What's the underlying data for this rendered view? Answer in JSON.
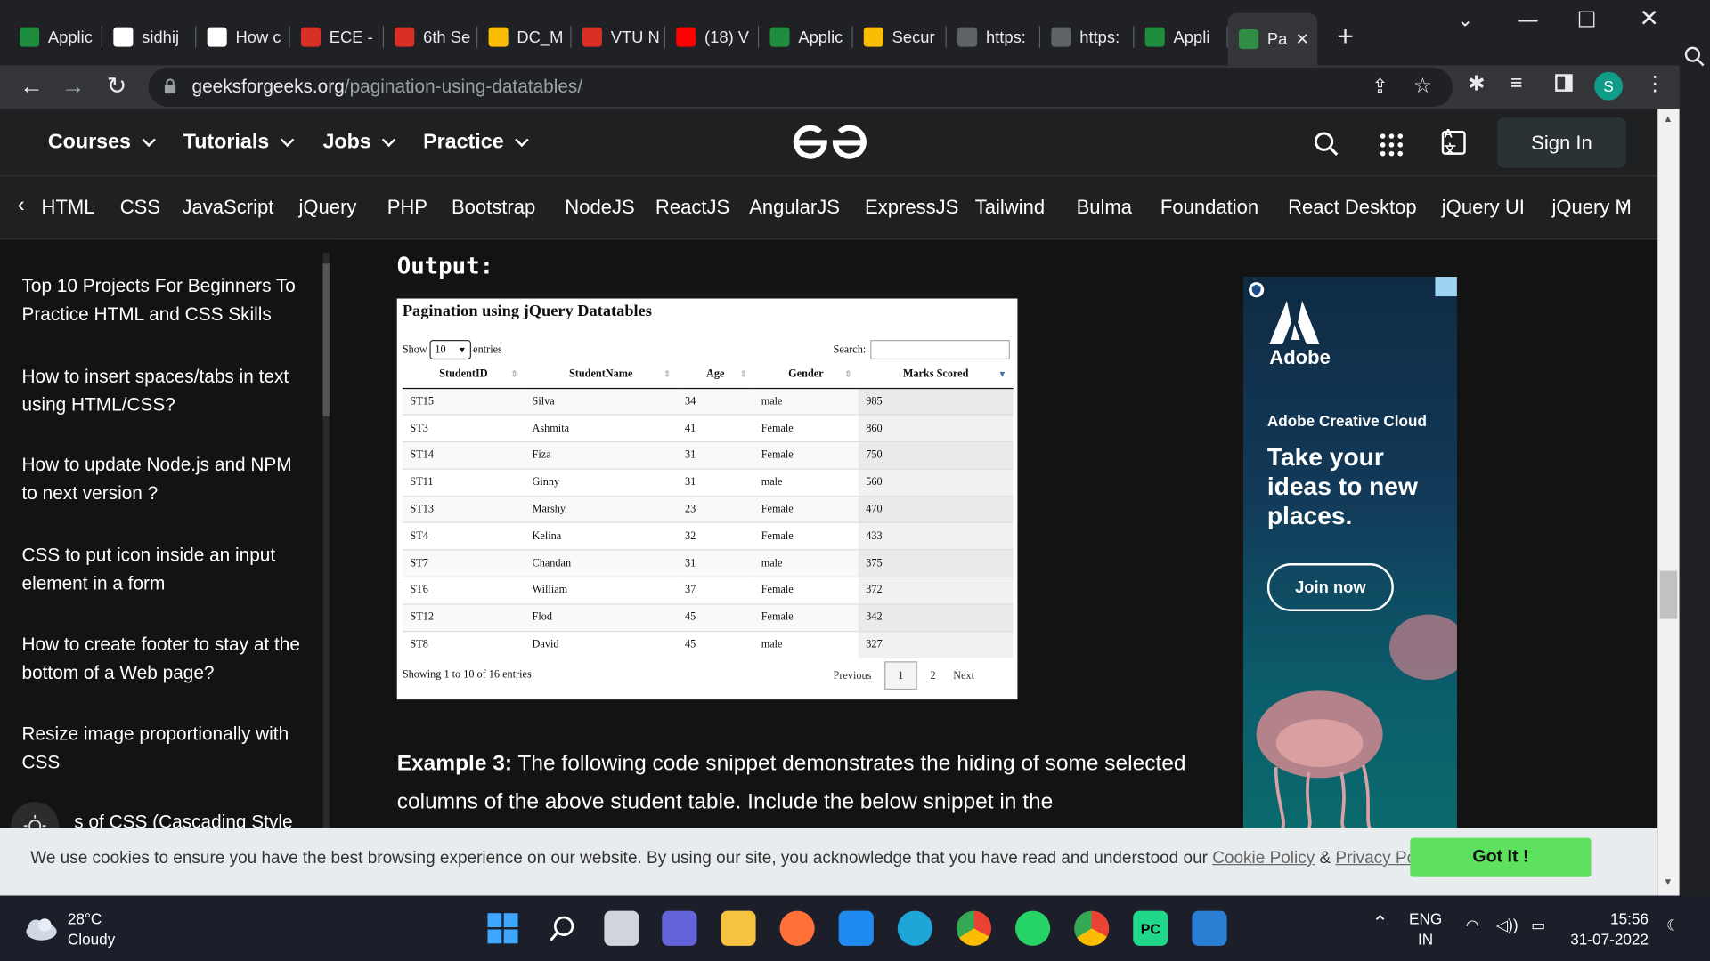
{
  "browser": {
    "tabs": [
      {
        "title": "Applic",
        "icon": "form-app-icon",
        "color": "#1e8e3e"
      },
      {
        "title": "sidhij",
        "icon": "github-icon",
        "color": "#ffffff"
      },
      {
        "title": "How c",
        "icon": "google-icon",
        "color": "#ffffff"
      },
      {
        "title": "ECE -",
        "icon": "pdf-icon",
        "color": "#d93025"
      },
      {
        "title": "6th Se",
        "icon": "pdf-icon",
        "color": "#d93025"
      },
      {
        "title": "DC_M",
        "icon": "drive-icon",
        "color": "#fbbc04"
      },
      {
        "title": "VTU N",
        "icon": "vtu-icon",
        "color": "#d93025"
      },
      {
        "title": "(18) V",
        "icon": "youtube-icon",
        "color": "#ff0000"
      },
      {
        "title": "Applic",
        "icon": "form-app-icon",
        "color": "#1e8e3e"
      },
      {
        "title": "Secur",
        "icon": "drive-icon",
        "color": "#fbbc04"
      },
      {
        "title": "https:",
        "icon": "loading-icon",
        "color": "#5f6368"
      },
      {
        "title": "https:",
        "icon": "loading-icon",
        "color": "#5f6368"
      },
      {
        "title": "Appli",
        "icon": "form-app-icon",
        "color": "#1e8e3e"
      },
      {
        "title": "Pa",
        "icon": "gfg-icon",
        "color": "#2f8d46",
        "active": true
      }
    ],
    "url_host": "geeksforgeeks.org",
    "url_path": "/pagination-using-datatables/",
    "profile_initial": "S"
  },
  "gfg_header": {
    "menus": [
      "Courses",
      "Tutorials",
      "Jobs",
      "Practice"
    ],
    "sign_in": "Sign In"
  },
  "subnav": [
    "HTML",
    "CSS",
    "JavaScript",
    "jQuery",
    "PHP",
    "Bootstrap",
    "NodeJS",
    "ReactJS",
    "AngularJS",
    "ExpressJS",
    "Tailwind",
    "Bulma",
    "Foundation",
    "React Desktop",
    "jQuery UI",
    "jQuery M"
  ],
  "sidebar": {
    "items": [
      "Top 10 Projects For Beginners To Practice HTML and CSS Skills",
      "How to insert spaces/tabs in text using HTML/CSS?",
      "How to update Node.js and NPM to next version ?",
      "CSS to put icon inside an input element in a form",
      "How to create footer to stay at the bottom of a Web page?",
      "Resize image proportionally with CSS",
      "s of CSS (Cascading Style"
    ]
  },
  "content": {
    "output_label": "Output:",
    "demo": {
      "title": "Pagination using jQuery Datatables",
      "show_label": "Show",
      "page_size": "10",
      "entries_label": "entries",
      "search_label": "Search:",
      "columns": [
        "StudentID",
        "StudentName",
        "Age",
        "Gender",
        "Marks Scored"
      ],
      "rows": [
        [
          "ST15",
          "Silva",
          "34",
          "male",
          "985"
        ],
        [
          "ST3",
          "Ashmita",
          "41",
          "Female",
          "860"
        ],
        [
          "ST14",
          "Fiza",
          "31",
          "Female",
          "750"
        ],
        [
          "ST11",
          "Ginny",
          "31",
          "male",
          "560"
        ],
        [
          "ST13",
          "Marshy",
          "23",
          "Female",
          "470"
        ],
        [
          "ST4",
          "Kelina",
          "32",
          "Female",
          "433"
        ],
        [
          "ST7",
          "Chandan",
          "31",
          "male",
          "375"
        ],
        [
          "ST6",
          "William",
          "37",
          "Female",
          "372"
        ],
        [
          "ST12",
          "Flod",
          "45",
          "Female",
          "342"
        ],
        [
          "ST8",
          "David",
          "45",
          "male",
          "327"
        ]
      ],
      "info": "Showing 1 to 10 of 16 entries",
      "pager": {
        "previous": "Previous",
        "pages": [
          "1",
          "2"
        ],
        "current": "1",
        "next": "Next"
      }
    },
    "example_label": "Example 3:",
    "example_text": " The following code snippet demonstrates the hiding of some selected columns of the above student table. Include the below snippet in the"
  },
  "ad": {
    "brand": "Adobe",
    "product": "Adobe Creative Cloud",
    "tagline": "Take your ideas to new places.",
    "cta": "Join now"
  },
  "cookie_bar": {
    "message": "We use cookies to ensure you have the best browsing experience on our website. By using our site, you acknowledge that you have read and understood our ",
    "cookie_policy": "Cookie Policy",
    "amp": " & ",
    "privacy_policy": "Privacy Policy",
    "button": "Got It !"
  },
  "taskbar": {
    "temperature": "28°C",
    "weather": "Cloudy",
    "language": "ENG",
    "region": "IN",
    "time": "15:56",
    "date": "31-07-2022"
  }
}
